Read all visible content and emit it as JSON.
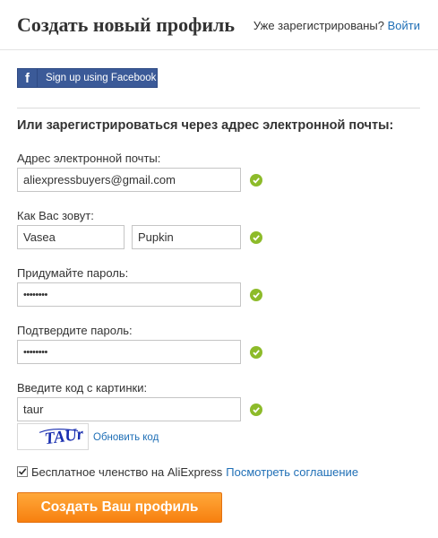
{
  "header": {
    "title": "Создать новый профиль",
    "already_registered": "Уже зарегистрированы?",
    "login_link": "Войти"
  },
  "facebook": {
    "icon_letter": "f",
    "label": "Sign up using Facebook"
  },
  "form": {
    "section_title": "Или зарегистрироваться через адрес электронной почты:",
    "email": {
      "label": "Адрес электронной почты:",
      "value": "aliexpressbuyers@gmail.com"
    },
    "name": {
      "label": "Как Вас зовут:",
      "first_value": "Vasea",
      "last_value": "Pupkin"
    },
    "password": {
      "label": "Придумайте пароль:",
      "value": "••••••••"
    },
    "confirm_password": {
      "label": "Подтвердите пароль:",
      "value": "••••••••"
    },
    "captcha": {
      "label": "Введите код с картинки:",
      "value": "taur",
      "refresh_label": "Обновить код",
      "image_text": "TAUr"
    },
    "agreement": {
      "text": "Бесплатное членство на AliExpress",
      "link": "Посмотреть соглашение",
      "checked": true
    },
    "submit_label": "Создать Ваш профиль"
  },
  "colors": {
    "facebook": "#3b5a98",
    "link": "#1f6fb6",
    "valid_check": "#8dbb2a",
    "submit": "#f7800f"
  }
}
